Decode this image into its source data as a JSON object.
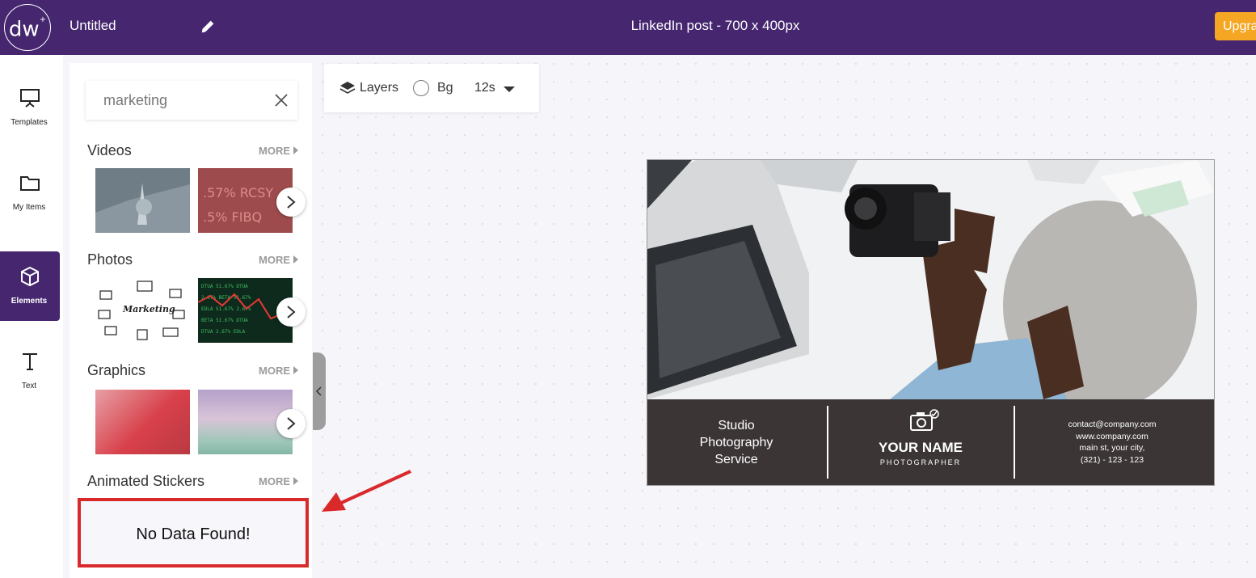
{
  "header": {
    "logo_text": "dw",
    "document_title": "Untitled",
    "canvas_size": "LinkedIn post - 700 x 400px",
    "upgrade_label": "Upgra"
  },
  "rail": {
    "items": [
      {
        "label": "Templates",
        "icon": "presentation-icon"
      },
      {
        "label": "My Items",
        "icon": "folder-icon"
      },
      {
        "label": "Elements",
        "icon": "cube-icon",
        "active": true
      },
      {
        "label": "Text",
        "icon": "text-t-icon"
      }
    ]
  },
  "panel": {
    "search_value": "marketing",
    "more_label": "MORE",
    "sections": [
      {
        "title": "Videos"
      },
      {
        "title": "Photos"
      },
      {
        "title": "Graphics"
      },
      {
        "title": "Animated Stickers"
      }
    ],
    "empty_message": "No Data Found!"
  },
  "toolbar": {
    "layers_label": "Layers",
    "bg_label": "Bg",
    "duration": "12s"
  },
  "design": {
    "studio_line1": "Studio",
    "studio_line2": "Photography",
    "studio_line3": "Service",
    "your_name": "YOUR NAME",
    "role": "PHOTOGRAPHER",
    "contact_email": "contact@company.com",
    "contact_web": "www.company.com",
    "contact_address": "main st, your city,",
    "contact_phone": "(321) - 123 - 123"
  },
  "colors": {
    "header_bg": "#45266f",
    "upgrade_bg": "#f5a623",
    "annotation_red": "#d9292b",
    "design_footer": "#3b3536"
  }
}
